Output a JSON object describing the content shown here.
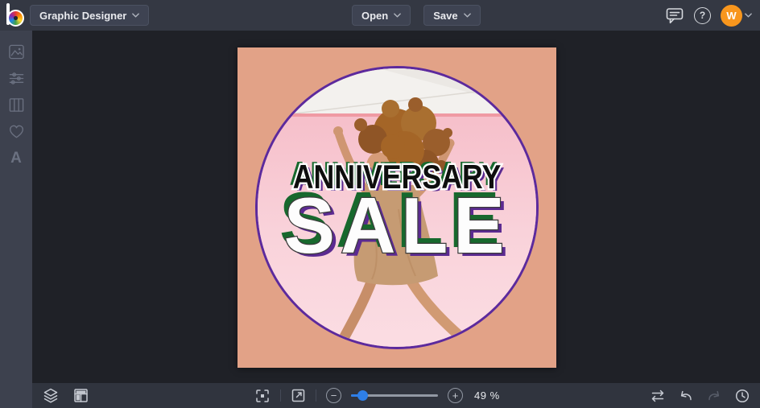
{
  "header": {
    "logo_name": "befunky-logo",
    "mode_button": {
      "label": "Graphic Designer"
    },
    "open_button": {
      "label": "Open"
    },
    "save_button": {
      "label": "Save"
    },
    "help_glyph": "?",
    "avatar": {
      "initial": "W"
    },
    "icons": [
      "feedback-chat-icon",
      "help-icon",
      "avatar-chevron-icon"
    ]
  },
  "sidebar": {
    "items": [
      {
        "name": "image-manager",
        "icon": "image-icon"
      },
      {
        "name": "edit-adjust",
        "icon": "adjust-sliders-icon"
      },
      {
        "name": "layouts",
        "icon": "columns-icon"
      },
      {
        "name": "favorites",
        "icon": "heart-icon"
      },
      {
        "name": "text-tool",
        "icon": "letter-a-icon",
        "glyph": "A"
      }
    ]
  },
  "canvas": {
    "artboard": {
      "headline_line1": "ANNIVERSARY",
      "headline_line2": "SALE",
      "colors": {
        "background": "#e2a287",
        "circle_border": "#5c2a9d",
        "photo_wall": "#f8cdd6",
        "text_green": "#17682d",
        "text_purple": "#5b2a91"
      }
    }
  },
  "footer": {
    "left_icons": [
      "layers-icon",
      "canvas-manager-icon"
    ],
    "view_icons": [
      "fit-screen-icon",
      "preview-icon"
    ],
    "zoom": {
      "out_glyph": "−",
      "in_glyph": "+",
      "percent": "49 %",
      "slider_value": 0.13
    },
    "history_icons": [
      "compare-icon",
      "undo-icon",
      "redo-icon",
      "history-icon"
    ]
  },
  "theme": {
    "topbar_bg": "#343843",
    "sidebar_bg": "#3d414e",
    "footer_bg": "#30343e",
    "canvas_bg": "#1f2127",
    "accent_blue": "#2e7fe8",
    "avatar_orange": "#f8961d"
  }
}
